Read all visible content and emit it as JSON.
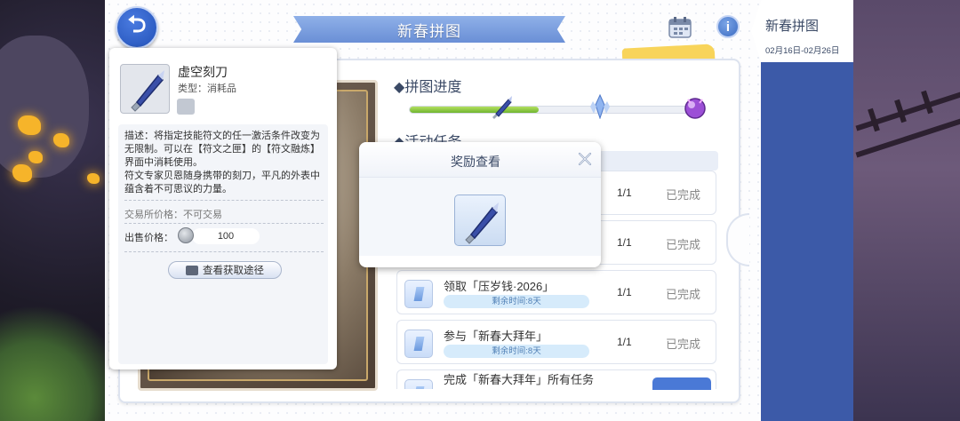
{
  "header": {
    "back_label": "⮌",
    "title": "新春拼图",
    "info_label": "i"
  },
  "event_tab": {
    "name": "新春拼图",
    "dates": "02月16日-02月26日"
  },
  "progress": {
    "title": "拼图进度",
    "fraction": 0.45
  },
  "tasks": {
    "title": "活动任务",
    "rows": [
      {
        "name": "",
        "time": "",
        "count": "1/1",
        "status": "已完成"
      },
      {
        "name": "",
        "time": "",
        "count": "1/1",
        "status": "已完成"
      },
      {
        "name": "领取「压岁钱·2026」",
        "time": "剩余时间:8天",
        "count": "1/1",
        "status": "已完成"
      },
      {
        "name": "参与「新春大拜年」",
        "time": "剩余时间:8天",
        "count": "1/1",
        "status": "已完成"
      },
      {
        "name": "完成「新春大拜年」所有任务",
        "time": "",
        "count": "",
        "status": ""
      }
    ]
  },
  "item": {
    "name": "虚空刻刀",
    "type": "类型：消耗品",
    "description": [
      "描述：将指定技能符文的任一激活条件改变为无限制。可以在【符文之匣】的【符文融炼】界面中消耗使用。",
      "符文专家贝恩随身携带的刻刀，平凡的外表中蕴含着不可思议的力量。"
    ],
    "trade_price": "交易所价格：不可交易",
    "sell_label": "出售价格：",
    "sell_price": "100",
    "source_button": "查看获取途径"
  },
  "reward_popup": {
    "title": "奖励查看"
  },
  "colors": {
    "accent_blue": "#3c5aa8",
    "progress_green": "#6fb530",
    "ribbon_blue": "#7a9ddf"
  }
}
